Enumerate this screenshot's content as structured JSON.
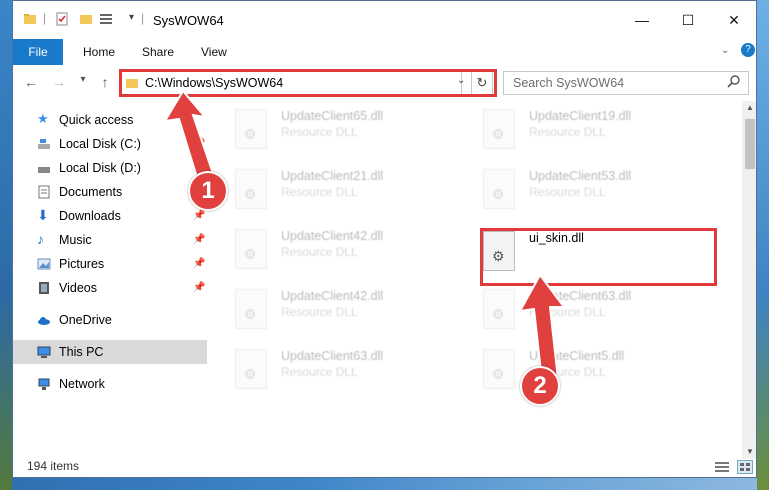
{
  "window": {
    "title": "SysWOW64"
  },
  "ribbon": {
    "tabs": [
      "File",
      "Home",
      "Share",
      "View"
    ]
  },
  "address": {
    "path": "C:\\Windows\\SysWOW64"
  },
  "search": {
    "placeholder": "Search SysWOW64"
  },
  "nav": {
    "items": [
      {
        "label": "Quick access"
      },
      {
        "label": "Local Disk (C:)"
      },
      {
        "label": "Local Disk (D:)"
      },
      {
        "label": "Documents"
      },
      {
        "label": "Downloads"
      },
      {
        "label": "Music"
      },
      {
        "label": "Pictures"
      },
      {
        "label": "Videos"
      },
      {
        "label": "OneDrive"
      },
      {
        "label": "This PC"
      },
      {
        "label": "Network"
      }
    ]
  },
  "files": [
    {
      "name": "UpdateClient65.dll",
      "type": "Resource DLL"
    },
    {
      "name": "UpdateClient19.dll",
      "type": "Resource DLL"
    },
    {
      "name": "UpdateClient21.dll",
      "type": "Resource DLL"
    },
    {
      "name": "UpdateClient53.dll",
      "type": "Resource DLL"
    },
    {
      "name": "UpdateClient42.dll",
      "type": "Resource DLL"
    },
    {
      "name": "ui_skin.dll",
      "type": ""
    },
    {
      "name": "UpdateClient42.dll",
      "type": "Resource DLL"
    },
    {
      "name": "UpdateClient63.dll",
      "type": "Resource DLL"
    },
    {
      "name": "UpdateClient63.dll",
      "type": "Resource DLL"
    },
    {
      "name": "UpdateClient5.dll",
      "type": "Resource DLL"
    }
  ],
  "status": {
    "count": "194 items"
  },
  "callouts": {
    "one": "1",
    "two": "2"
  },
  "colors": {
    "accent": "#1979ca",
    "annotation": "#e03a3a"
  }
}
